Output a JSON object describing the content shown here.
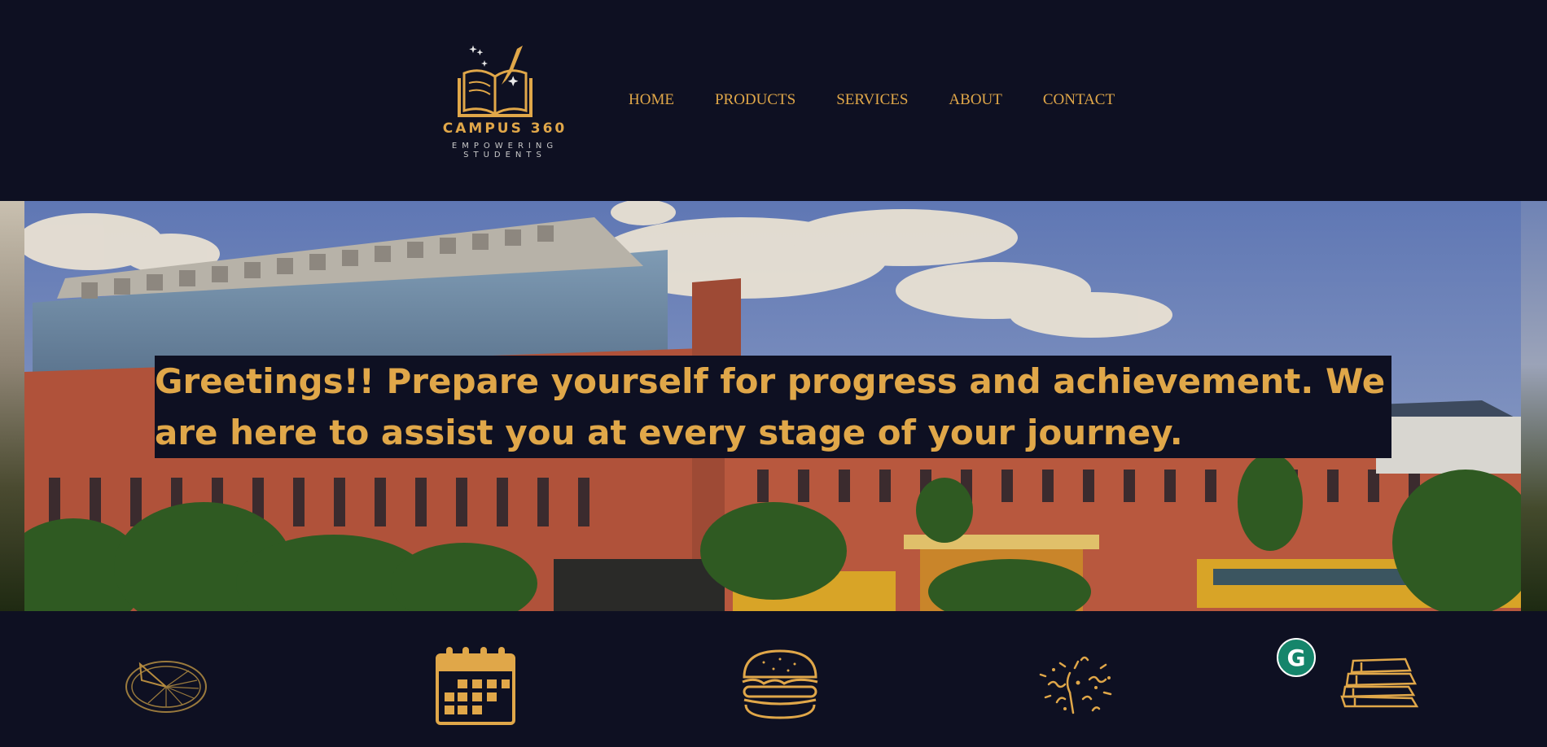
{
  "brand": {
    "name": "CAMPUS 360",
    "tagline": "EMPOWERING STUDENTS"
  },
  "nav": {
    "items": [
      {
        "label": "HOME"
      },
      {
        "label": "PRODUCTS"
      },
      {
        "label": "SERVICES"
      },
      {
        "label": "ABOUT"
      },
      {
        "label": "CONTACT"
      }
    ]
  },
  "hero": {
    "message": "Greetings!! Prepare yourself for progress and achievement. We are here to assist you at every stage of your journey."
  },
  "feature_icons": [
    {
      "icon": "sundial-icon"
    },
    {
      "icon": "calendar-icon"
    },
    {
      "icon": "burger-icon"
    },
    {
      "icon": "confetti-icon"
    },
    {
      "icon": "books-icon"
    }
  ],
  "widgets": {
    "grammarly_letter": "G"
  },
  "colors": {
    "background": "#0e1022",
    "accent": "#e0a749",
    "grammarly": "#15856b"
  }
}
